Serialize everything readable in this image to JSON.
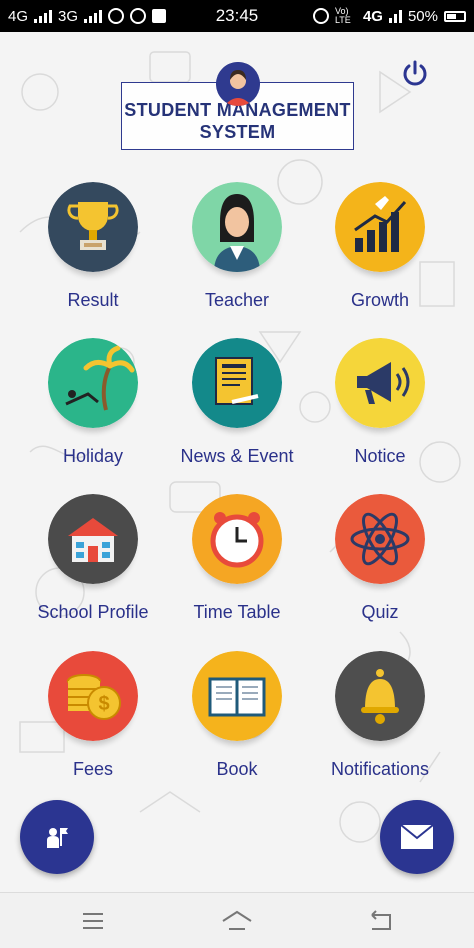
{
  "status_bar": {
    "left_net_1": "4G",
    "left_net_2": "3G",
    "time": "23:45",
    "right_lte": "Vo) LTE",
    "right_net": "4G",
    "battery": "50%"
  },
  "header": {
    "title_line1": "STUDENT MANAGEMENT",
    "title_line2": "SYSTEM"
  },
  "menu": [
    {
      "label": "Result",
      "color": "#34495e"
    },
    {
      "label": "Teacher",
      "color": "#7fd6a7"
    },
    {
      "label": "Growth",
      "color": "#f4b41a"
    },
    {
      "label": "Holiday",
      "color": "#2bb58a"
    },
    {
      "label": "News & Event",
      "color": "#13898a"
    },
    {
      "label": "Notice",
      "color": "#f5d63a"
    },
    {
      "label": "School Profile",
      "color": "#4b4b4b"
    },
    {
      "label": "Time Table",
      "color": "#f5a623"
    },
    {
      "label": "Quiz",
      "color": "#ea5a3c"
    },
    {
      "label": "Fees",
      "color": "#e84a3b"
    },
    {
      "label": "Book",
      "color": "#f5b31c"
    },
    {
      "label": "Notifications",
      "color": "#4e4e4e"
    }
  ],
  "colors": {
    "accent": "#2b3591",
    "label": "#2a318a"
  }
}
